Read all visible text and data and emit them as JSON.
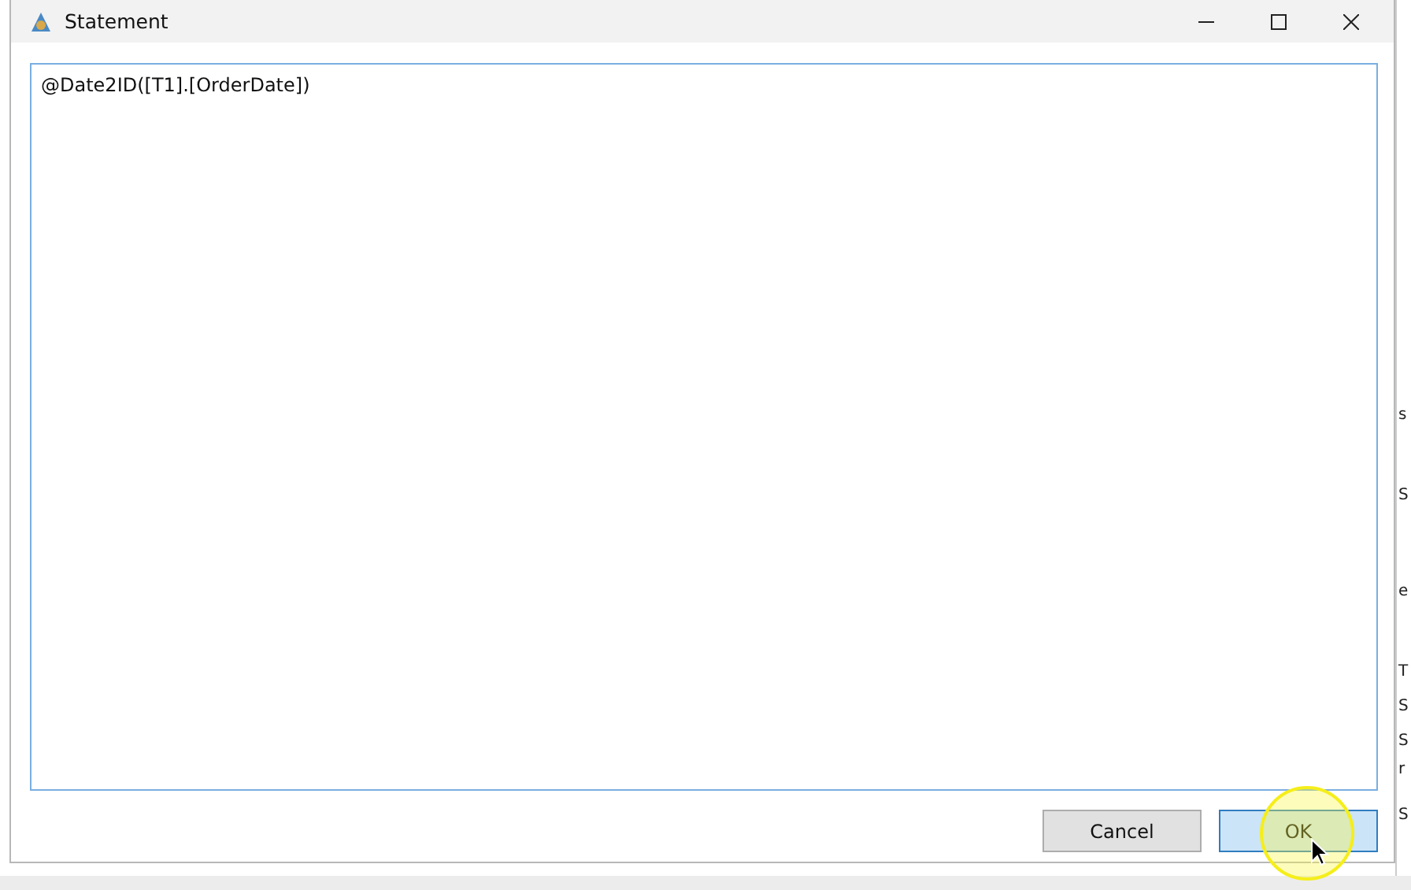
{
  "window": {
    "title": "Statement"
  },
  "editor": {
    "value": "@Date2ID([T1].[OrderDate])"
  },
  "buttons": [
    {
      "label": "Cancel",
      "kind": "normal"
    },
    {
      "label": "OK",
      "kind": "default"
    }
  ],
  "background_window": {
    "fragments": [
      "s",
      "S",
      "e",
      "T",
      "S",
      "S",
      "r",
      "S"
    ]
  }
}
